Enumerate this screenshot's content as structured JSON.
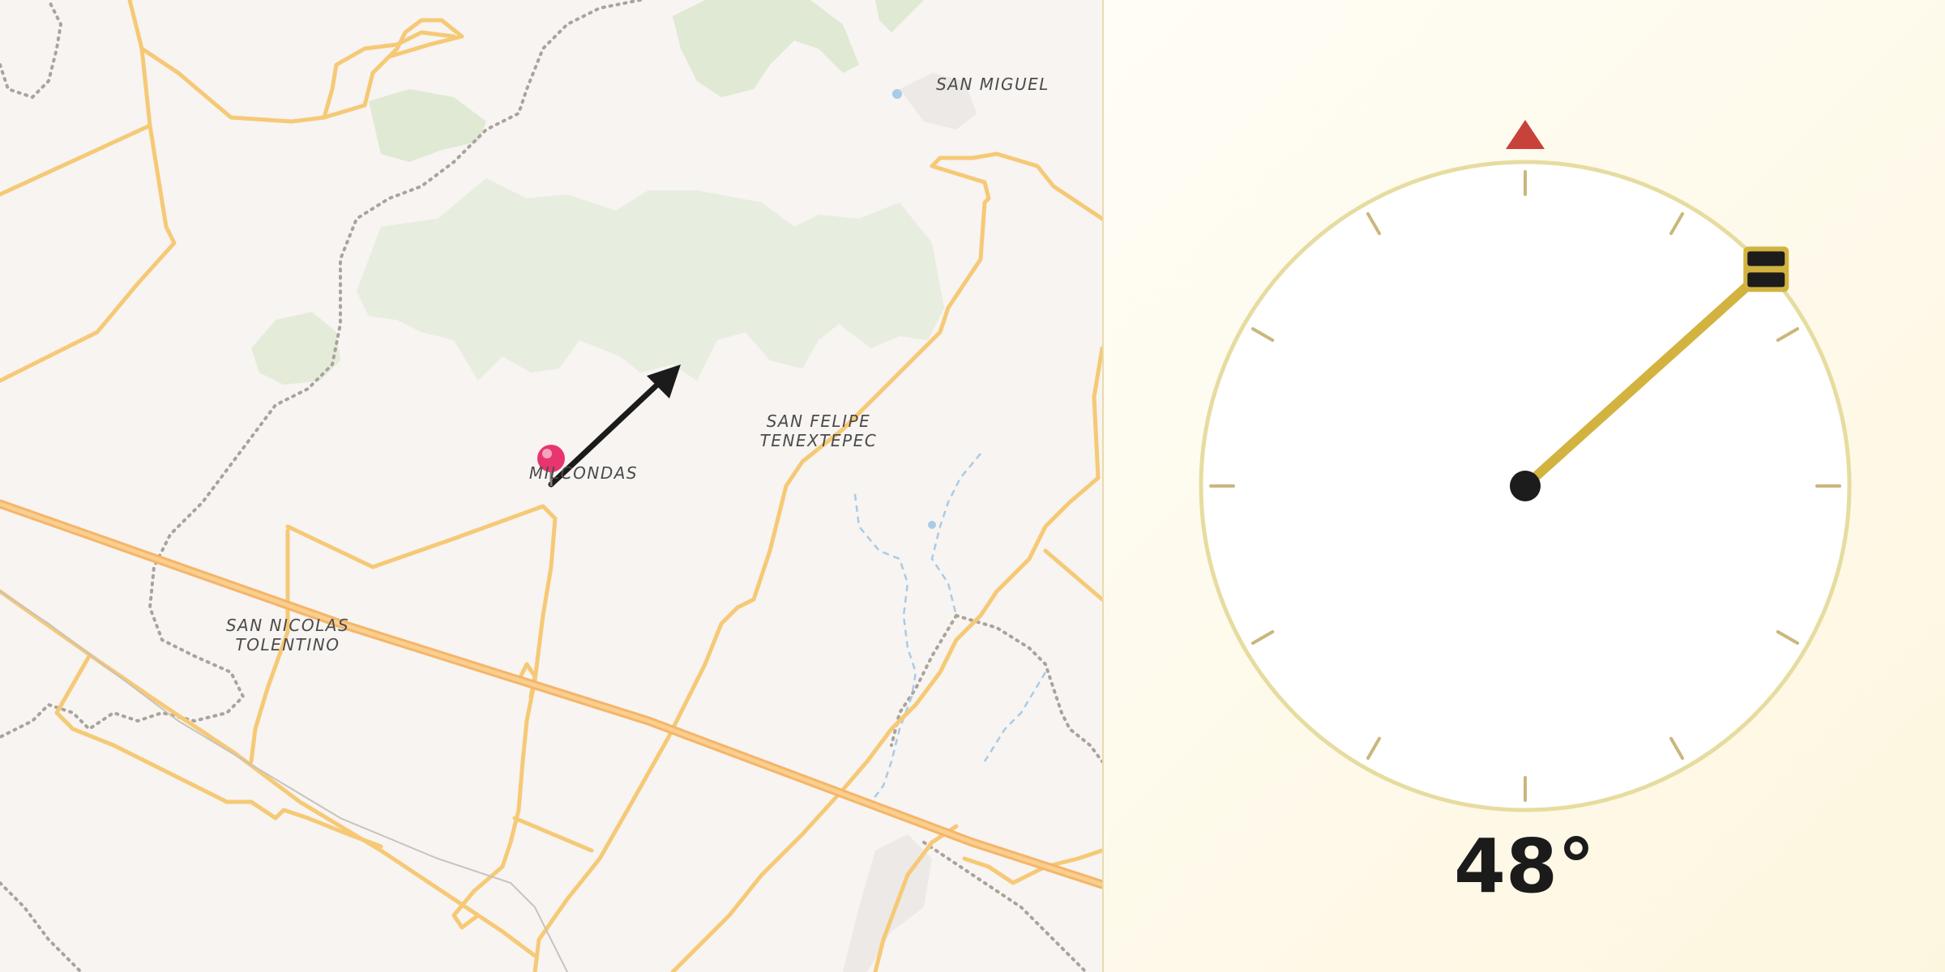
{
  "map": {
    "places": [
      {
        "id": "san-miguel",
        "label": "SAN MIGUEL"
      },
      {
        "id": "san-felipe",
        "label": "SAN FELIPE\nTENEXTEPEC"
      },
      {
        "id": "milcondas",
        "label": "MILCONDAS"
      },
      {
        "id": "san-nicolas",
        "label": "SAN NICOLAS\nTOLENTINO"
      }
    ],
    "marker_icon": "map-pin-icon",
    "heading_arrow_icon": "direction-arrow-icon",
    "colors": {
      "road": "#f6c976",
      "highway": "#f5b56a",
      "forest": "#dbe8cf",
      "water": "#a9cbe6",
      "boundary": "#a9a29b"
    }
  },
  "compass": {
    "heading_deg": 48,
    "readout": "48°",
    "north_marker_icon": "north-triangle-icon",
    "needle_handle_icon": "needle-handle-icon",
    "colors": {
      "ring": "#e7dca0",
      "needle": "#d3b340",
      "north": "#c8423a",
      "hub": "#1c1c1c"
    }
  }
}
